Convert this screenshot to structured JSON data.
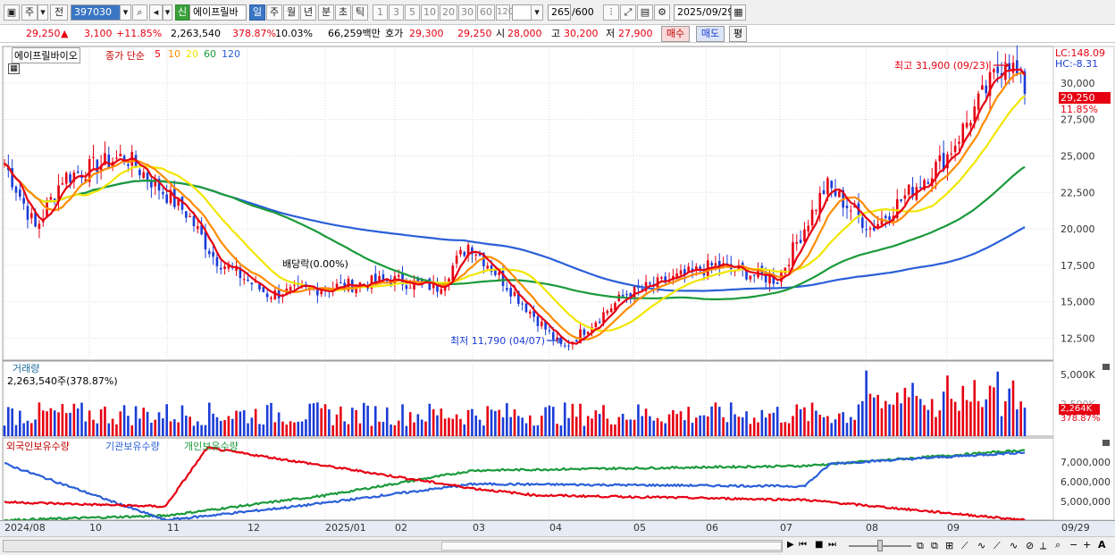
{
  "toolbar": {
    "market": "주",
    "prev": "전",
    "code": "397030",
    "new_badge": "신",
    "stock_name": "에이프릴바",
    "periods": [
      "일",
      "주",
      "월",
      "년",
      "분",
      "초",
      "틱"
    ],
    "selected_period": "일",
    "intervals": [
      "1",
      "3",
      "5",
      "10",
      "20",
      "30",
      "60",
      "120"
    ],
    "count": "265",
    "count_max": "/600",
    "date": "2025/09/29"
  },
  "quote": {
    "price": "29,250",
    "change": "3,100",
    "change_pct": "+11.85%",
    "volume": "2,263,540",
    "volume_ratio": "378.87%",
    "turnover": "10.03%",
    "amount": "66,259백만",
    "hoga_label": "호가",
    "ask": "29,300",
    "bid": "29,250",
    "open_label": "시",
    "open": "28,000",
    "high_label": "고",
    "high": "30,200",
    "low_label": "저",
    "low": "27,900",
    "buy_label": "매수",
    "sell_label": "매도",
    "eval_label": "평"
  },
  "price_pane": {
    "legend_name": "에이프릴바이오",
    "legend_ma": "종가 단순",
    "ma_periods": [
      {
        "label": "5",
        "color": "#e60012"
      },
      {
        "label": "10",
        "color": "#ff8c00"
      },
      {
        "label": "20",
        "color": "#f2e600"
      },
      {
        "label": "60",
        "color": "#1a9a3a"
      },
      {
        "label": "120",
        "color": "#2a5fd8"
      }
    ],
    "lc": "LC:148.09",
    "hc": "HC:-8.31",
    "max_note": "최고 31,900 (09/23)",
    "min_note": "최저 11,790 (04/07)",
    "div_note": "배당락(0.00%)",
    "current_tag": "29,250",
    "current_pct": "11.85%",
    "yticks": [
      "30,000",
      "27,500",
      "25,000",
      "22,500",
      "20,000",
      "17,500",
      "15,000",
      "12,500"
    ]
  },
  "volume_pane": {
    "title": "거래량",
    "value": "2,263,540주(378.87%)",
    "ytick_top": "5,000K",
    "ytick_mid": "2,500K",
    "current_tag": "2,264K",
    "current_pct": "378.87%"
  },
  "holding_pane": {
    "legend": [
      {
        "label": "외국인보유수량",
        "color": "#e60012"
      },
      {
        "label": "기관보유수량",
        "color": "#2a5fd8"
      },
      {
        "label": "개인보유수량",
        "color": "#1a9a3a"
      }
    ],
    "yticks": [
      "7,000,000",
      "6,000,000",
      "5,000,000"
    ]
  },
  "x_axis": {
    "labels": [
      "2024/08",
      "10",
      "11",
      "12",
      "2025/01",
      "02",
      "03",
      "04",
      "05",
      "06",
      "07",
      "08",
      "09"
    ],
    "end_label": "09/29"
  },
  "colors": {
    "up": "#e60012",
    "down": "#1a3cd6",
    "ma5": "#e60012",
    "ma10": "#ff8c00",
    "ma20": "#f2e600",
    "ma60": "#1a9a3a",
    "ma120": "#2a5fd8"
  },
  "chart_data": {
    "type": "candlestick",
    "x_range": [
      "2024/08",
      "2025/09/29"
    ],
    "price_ylim": [
      11000,
      32500
    ],
    "price_anchors": [
      {
        "date": "2024/08",
        "close": 24500
      },
      {
        "date": "2024/08 mid",
        "close": 20000
      },
      {
        "date": "2024/09",
        "close": 23500
      },
      {
        "date": "2024/10",
        "close": 25000
      },
      {
        "date": "2024/11",
        "close": 21000
      },
      {
        "date": "2024/11 late",
        "close": 18000
      },
      {
        "date": "2024/12",
        "close": 15500
      },
      {
        "date": "2025/01",
        "close": 16500
      },
      {
        "date": "2025/02",
        "close": 16000
      },
      {
        "date": "2025/03",
        "close": 19000
      },
      {
        "date": "2025/03 mid",
        "close": 17000
      },
      {
        "date": "2025/04/07",
        "close": 11790
      },
      {
        "date": "2025/05",
        "close": 15500
      },
      {
        "date": "2025/06",
        "close": 17500
      },
      {
        "date": "2025/07",
        "close": 16500
      },
      {
        "date": "2025/07 late",
        "close": 23000
      },
      {
        "date": "2025/08",
        "close": 20000
      },
      {
        "date": "2025/09",
        "close": 25000
      },
      {
        "date": "2025/09/23",
        "close": 31900
      },
      {
        "date": "2025/09/29",
        "close": 29250
      }
    ],
    "holding_ylim": [
      4400000,
      7800000
    ],
    "foreign_holding": [
      {
        "date": "2024/08",
        "value": 5200000
      },
      {
        "date": "2024/11",
        "value": 5000000
      },
      {
        "date": "2024/11 late",
        "value": 7600000
      },
      {
        "date": "2025/03",
        "value": 5800000
      },
      {
        "date": "2025/04",
        "value": 5500000
      },
      {
        "date": "2025/07",
        "value": 5300000
      },
      {
        "date": "2025/09/29",
        "value": 4400000
      }
    ],
    "inst_holding": [
      {
        "date": "2024/08",
        "value": 6900000
      },
      {
        "date": "2024/11",
        "value": 4400000
      },
      {
        "date": "2025/01",
        "value": 5000000
      },
      {
        "date": "2025/03",
        "value": 6000000
      },
      {
        "date": "2025/07",
        "value": 5900000
      },
      {
        "date": "2025/07 late",
        "value": 6900000
      },
      {
        "date": "2025/09/29",
        "value": 7400000
      }
    ],
    "indiv_holding": [
      {
        "date": "2024/08",
        "value": 4400000
      },
      {
        "date": "2024/11",
        "value": 4600000
      },
      {
        "date": "2025/01",
        "value": 5500000
      },
      {
        "date": "2025/03",
        "value": 6600000
      },
      {
        "date": "2025/07",
        "value": 6800000
      },
      {
        "date": "2025/09/29",
        "value": 7500000
      }
    ]
  }
}
